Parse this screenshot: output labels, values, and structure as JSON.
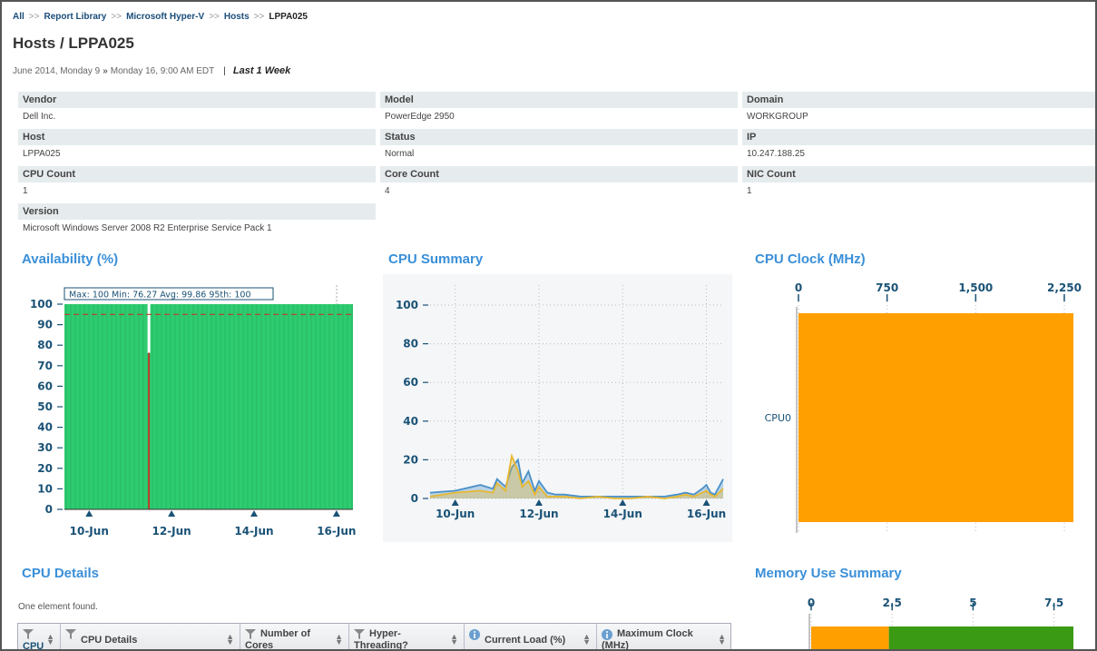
{
  "breadcrumb": [
    {
      "label": "All",
      "link": true
    },
    {
      "label": "Report Library",
      "link": true
    },
    {
      "label": "Microsoft Hyper-V",
      "link": true
    },
    {
      "label": "Hosts",
      "link": true
    },
    {
      "label": "LPPA025",
      "link": false
    }
  ],
  "breadcrumb_sep": ">>",
  "title": "Hosts / LPPA025",
  "daterange": {
    "start": "June 2014, Monday 9",
    "sep": "»",
    "end": "Monday 16, 9:00 AM EDT",
    "pipe": "|",
    "period": "Last 1 Week"
  },
  "properties": [
    {
      "label": "Vendor",
      "value": "Dell Inc."
    },
    {
      "label": "Model",
      "value": "PowerEdge 2950"
    },
    {
      "label": "Domain",
      "value": "WORKGROUP"
    },
    {
      "label": "Host",
      "value": "LPPA025"
    },
    {
      "label": "Status",
      "value": "Normal"
    },
    {
      "label": "IP",
      "value": "10.247.188.25"
    },
    {
      "label": "CPU Count",
      "value": "1"
    },
    {
      "label": "Core Count",
      "value": "4"
    },
    {
      "label": "NIC Count",
      "value": "1"
    },
    {
      "label": "Version",
      "value": "Microsoft Windows Server 2008 R2 Enterprise Service Pack 1"
    }
  ],
  "sections": {
    "availability": "Availability (%)",
    "cpu_summary": "CPU Summary",
    "cpu_clock": "CPU Clock (MHz)",
    "cpu_details": "CPU Details",
    "memory": "Memory Use Summary"
  },
  "colors": {
    "accent": "#3a8fd8",
    "availability_fill": "#2ecc71",
    "orange": "#ff9f00",
    "green": "#3a9a14",
    "axis_text": "#1a5276"
  },
  "chart_data": [
    {
      "type": "area",
      "title": "Availability (%)",
      "stats_box": "Max: 100   Min: 76.27   Avg: 99.86   95th: 100",
      "x_ticks": [
        "10-Jun",
        "12-Jun",
        "14-Jun",
        "16-Jun"
      ],
      "ylim": [
        0,
        100
      ],
      "y_ticks": [
        0,
        10,
        20,
        30,
        40,
        50,
        60,
        70,
        80,
        90,
        100
      ],
      "threshold": 95,
      "x_range": [
        9.4,
        16.4
      ],
      "series": [
        {
          "values_x": [
            9.4,
            11.45,
            11.45,
            11.55,
            11.55,
            16.4
          ],
          "values_y": [
            100,
            100,
            76.27,
            76.27,
            100,
            100
          ]
        }
      ],
      "grid": true
    },
    {
      "type": "line",
      "title": "CPU Summary",
      "x_ticks": [
        "10-Jun",
        "12-Jun",
        "14-Jun",
        "16-Jun"
      ],
      "ylim": [
        0,
        100
      ],
      "y_ticks": [
        0,
        20,
        40,
        60,
        80,
        100
      ],
      "x_range": [
        9.4,
        16.4
      ],
      "series": [
        {
          "values_x": [
            9.4,
            10.0,
            10.6,
            10.9,
            11.0,
            11.2,
            11.35,
            11.5,
            11.6,
            11.75,
            11.9,
            12.0,
            12.2,
            12.4,
            12.6,
            13.0,
            13.4,
            13.8,
            14.2,
            14.6,
            15.0,
            15.3,
            15.5,
            15.7,
            15.9,
            16.0,
            16.1,
            16.2,
            16.4
          ],
          "values_y": [
            3,
            4,
            7,
            5,
            10,
            6,
            16,
            20,
            8,
            14,
            4,
            9,
            3,
            2,
            2,
            1,
            1,
            1,
            1,
            1,
            1,
            2,
            3,
            2,
            5,
            7,
            3,
            2,
            10
          ]
        },
        {
          "values_x": [
            9.4,
            10.0,
            10.6,
            10.9,
            11.0,
            11.2,
            11.35,
            11.5,
            11.6,
            11.75,
            11.9,
            12.0,
            12.2,
            12.4,
            12.6,
            13.0,
            13.4,
            13.8,
            14.2,
            14.6,
            15.0,
            15.3,
            15.5,
            15.7,
            15.9,
            16.0,
            16.1,
            16.2,
            16.4
          ],
          "values_y": [
            1,
            3,
            4,
            3,
            8,
            4,
            22,
            14,
            6,
            9,
            2,
            6,
            1,
            1,
            1,
            0,
            1,
            0,
            0,
            1,
            0,
            1,
            2,
            1,
            3,
            4,
            2,
            1,
            5
          ]
        }
      ],
      "series_colors": [
        "#4a90c8",
        "#e8b830"
      ],
      "grid": true
    },
    {
      "type": "bar",
      "title": "CPU Clock (MHz)",
      "categories": [
        "CPU0"
      ],
      "values": [
        2327
      ],
      "x_ticks": [
        "0",
        "750",
        "1,500",
        "2,250"
      ],
      "xlim": [
        0,
        2327
      ],
      "orientation": "horizontal"
    },
    {
      "type": "bar",
      "title": "Memory Use Summary",
      "categories": [
        ""
      ],
      "series": [
        {
          "values": [
            2.4
          ]
        },
        {
          "values": [
            5.7
          ]
        }
      ],
      "x_ticks": [
        "0",
        "2.5",
        "5",
        "7.5"
      ],
      "xlim": [
        0,
        8.1
      ],
      "orientation": "horizontal",
      "stacked": true
    }
  ],
  "cpu_details": {
    "info": "One element found.",
    "columns": [
      {
        "label": "CPU",
        "icon": "filter-icon"
      },
      {
        "label": "CPU Details",
        "icon": "filter-icon"
      },
      {
        "label": "Number of\nCores",
        "icon": "filter-icon"
      },
      {
        "label": "Hyper-\nThreading?",
        "icon": "filter-icon"
      },
      {
        "label": "Current Load (%)",
        "icon": "info-icon"
      },
      {
        "label": "Maximum Clock\n(MHz)",
        "icon": "info-icon"
      }
    ]
  }
}
